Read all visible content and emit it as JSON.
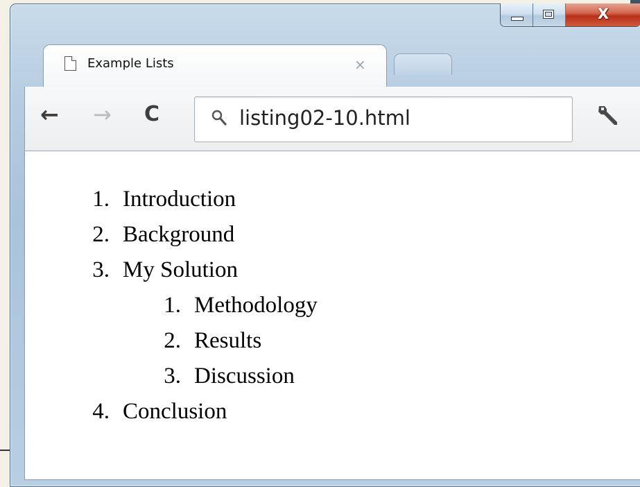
{
  "window": {
    "caption": {
      "minimize_icon": "minimize-icon",
      "maximize_icon": "maximize-icon",
      "close_icon": "close-icon"
    }
  },
  "tab": {
    "title": "Example Lists",
    "close_glyph": "×",
    "icon": "page-icon"
  },
  "toolbar": {
    "back_glyph": "←",
    "forward_glyph": "→",
    "reload_glyph": "C",
    "url": "listing02-10.html",
    "search_icon": "search-icon",
    "wrench_icon": "wrench-icon"
  },
  "content": {
    "list": [
      {
        "number": "1.",
        "text": "Introduction"
      },
      {
        "number": "2.",
        "text": "Background"
      },
      {
        "number": "3.",
        "text": "My Solution",
        "children": [
          {
            "number": "1.",
            "text": "Methodology"
          },
          {
            "number": "2.",
            "text": "Results"
          },
          {
            "number": "3.",
            "text": "Discussion"
          }
        ]
      },
      {
        "number": "4.",
        "text": "Conclusion"
      }
    ]
  },
  "colors": {
    "frame": "#b7cde1",
    "close_button": "#c8472c",
    "page_background": "#ffffff"
  }
}
